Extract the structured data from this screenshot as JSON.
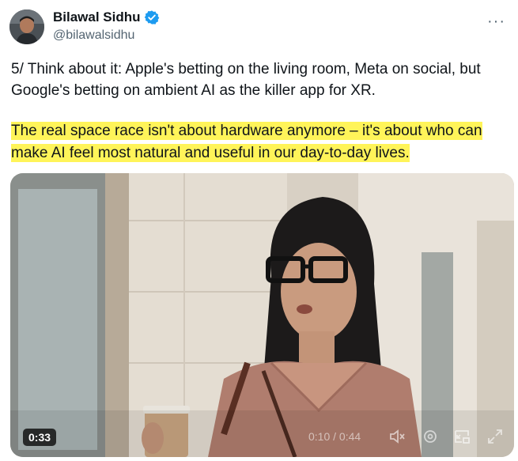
{
  "author": {
    "name": "Bilawal Sidhu",
    "handle": "@bilawalsidhu"
  },
  "menu": {
    "more_label": "···"
  },
  "tweet": {
    "paragraph1": "5/ Think about it: Apple's betting on the living room, Meta on social, but Google's betting on ambient AI as the killer app for XR.",
    "paragraph2": "The real space race isn't about hardware anymore – it's about who can make AI feel most natural and useful in our day-to-day lives."
  },
  "video": {
    "timer": "0:33",
    "progress_text": "0:10 / 0:44",
    "icons": [
      "volume-icon",
      "settings-icon",
      "pip-icon",
      "fullscreen-icon"
    ]
  },
  "colors": {
    "verified": "#1d9bf0",
    "highlight": "#fff459",
    "handle": "#536471"
  }
}
